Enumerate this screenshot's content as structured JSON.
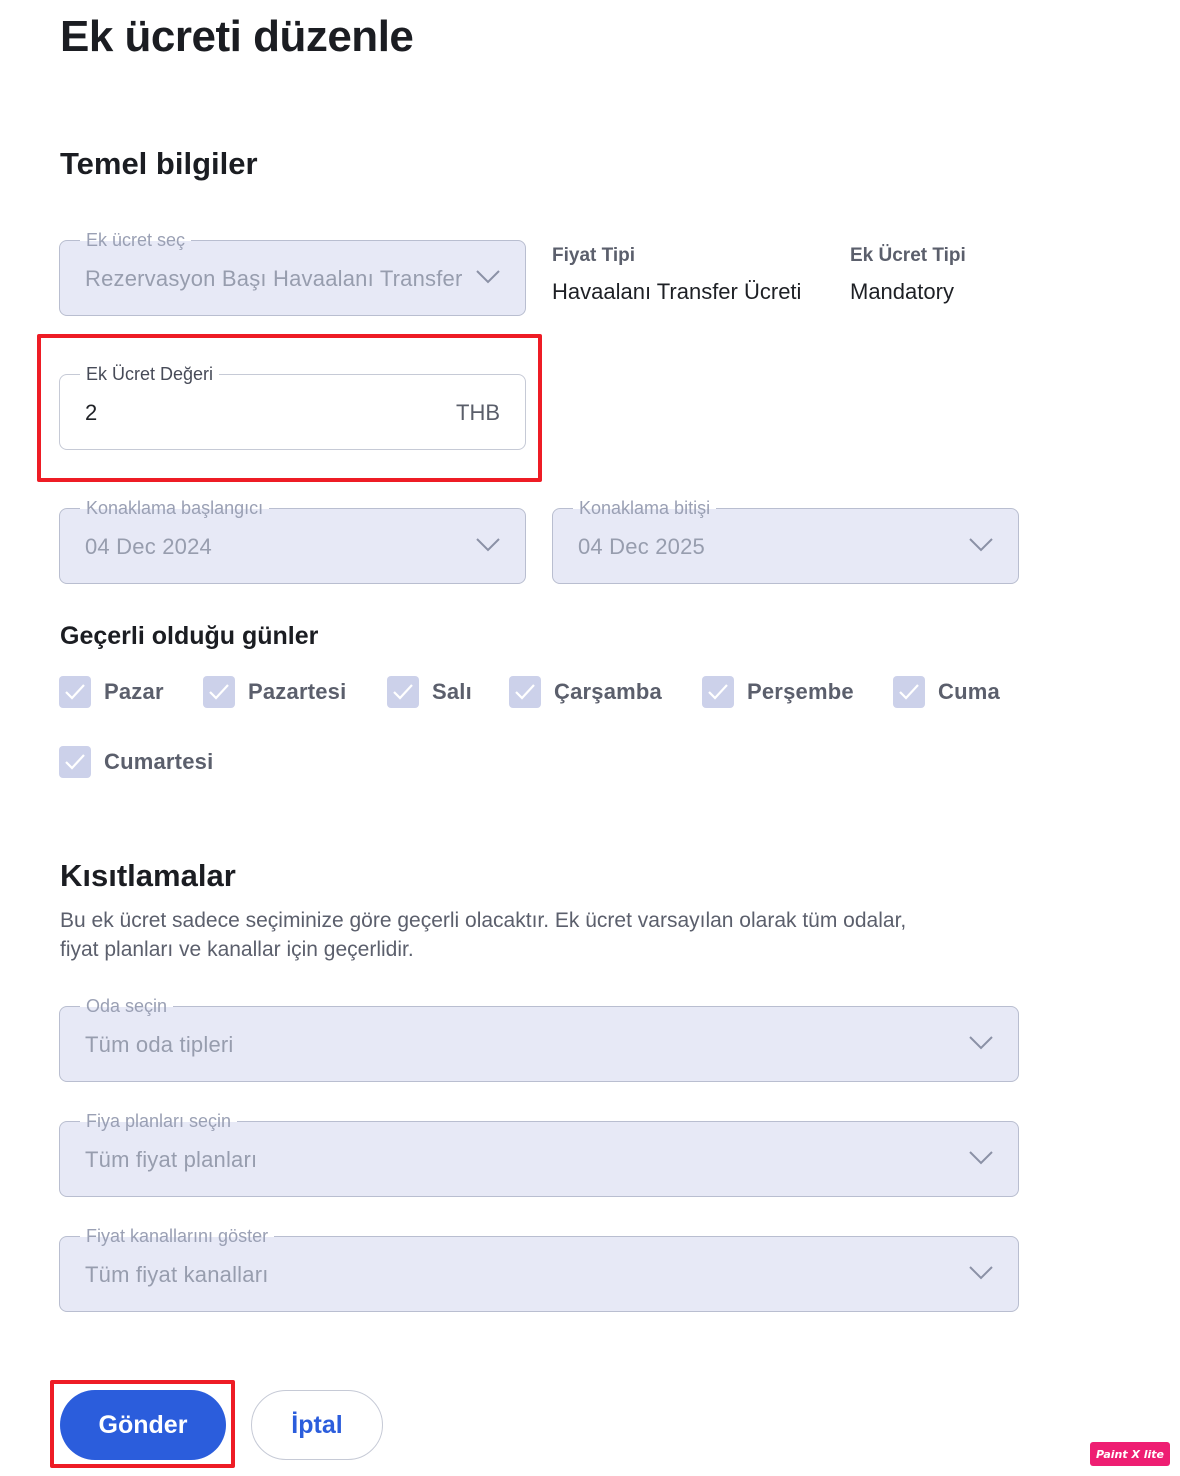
{
  "page": {
    "title": "Ek ücreti düzenle"
  },
  "basic": {
    "section_title": "Temel bilgiler",
    "surcharge_select": {
      "label": "Ek ücret seç",
      "value": "Rezervasyon Başı Havaalanı Transfer"
    },
    "price_type": {
      "label": "Fiyat Tipi",
      "value": "Havaalanı Transfer Ücreti"
    },
    "surcharge_type": {
      "label": "Ek Ücret Tipi",
      "value": "Mandatory"
    },
    "surcharge_value": {
      "label": "Ek Ücret Değeri",
      "value": "2",
      "currency": "THB"
    },
    "stay_start": {
      "label": "Konaklama başlangıcı",
      "value": "04 Dec 2024"
    },
    "stay_end": {
      "label": "Konaklama bitişi",
      "value": "04 Dec 2025"
    },
    "days_title": "Geçerli olduğu günler",
    "days": [
      {
        "label": "Pazar",
        "checked": true
      },
      {
        "label": "Pazartesi",
        "checked": true
      },
      {
        "label": "Salı",
        "checked": true
      },
      {
        "label": "Çarşamba",
        "checked": true
      },
      {
        "label": "Perşembe",
        "checked": true
      },
      {
        "label": "Cuma",
        "checked": true
      },
      {
        "label": "Cumartesi",
        "checked": true
      }
    ]
  },
  "restrictions": {
    "section_title": "Kısıtlamalar",
    "description_line1": "Bu ek ücret sadece seçiminize göre geçerli olacaktır. Ek ücret varsayılan olarak tüm odalar,",
    "description_line2": "fiyat planları ve kanallar için geçerlidir.",
    "room": {
      "label": "Oda seçin",
      "value": "Tüm oda tipleri"
    },
    "rate_plans": {
      "label": "Fiya planları seçin",
      "value": "Tüm fiyat planları"
    },
    "channels": {
      "label": "Fiyat kanallarını göster",
      "value": "Tüm fiyat kanalları"
    }
  },
  "actions": {
    "submit": "Gönder",
    "cancel": "İptal"
  },
  "watermark": "Paint X lite",
  "colors": {
    "primary": "#2b5ddc",
    "highlight": "#ee1c25",
    "disabled_bg": "#e7e9f6",
    "checkbox": "#ccd1ea"
  }
}
